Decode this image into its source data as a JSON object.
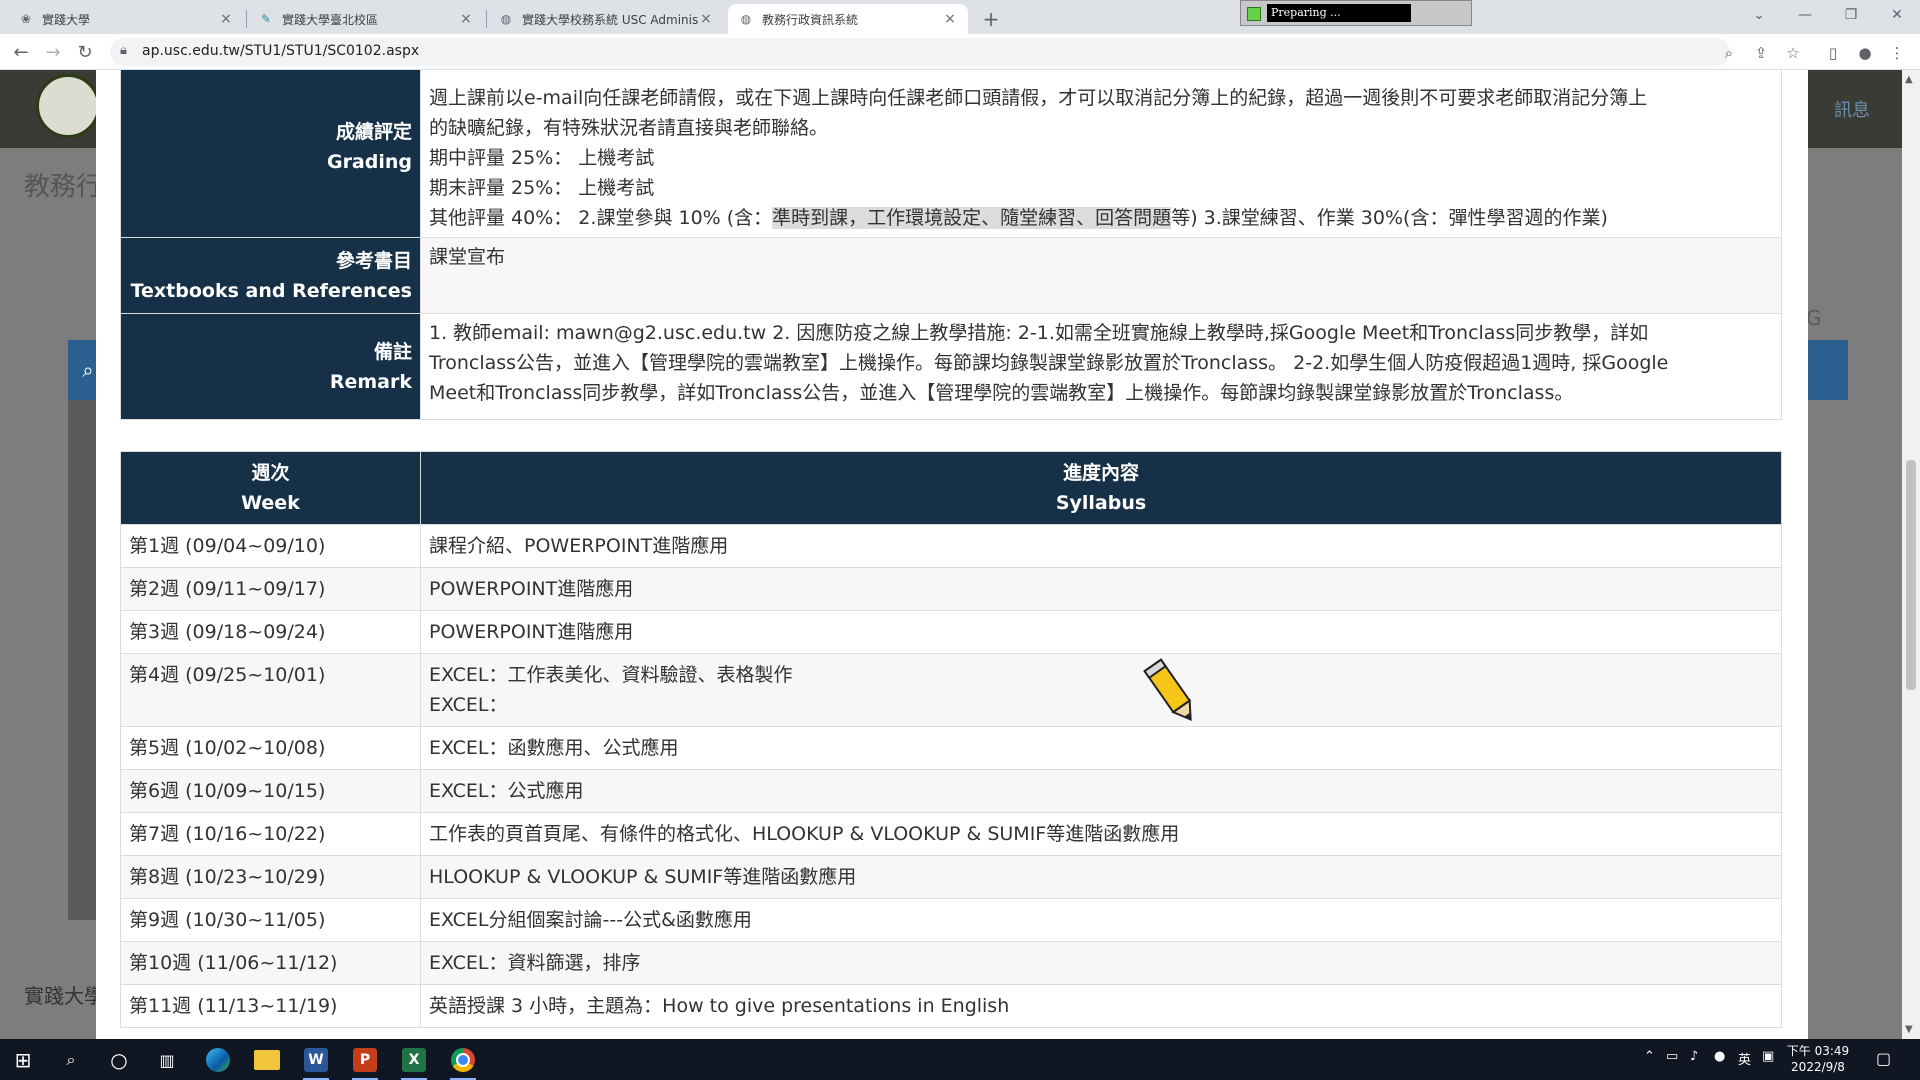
{
  "browser": {
    "tabs": [
      {
        "title": "實踐大學",
        "active": false
      },
      {
        "title": "實踐大學臺北校區",
        "active": false
      },
      {
        "title": "實踐大學校務系統 USC Adminis",
        "active": false
      },
      {
        "title": "教務行政資訊系統",
        "active": true
      }
    ],
    "new_tab": "+",
    "preparing_label": "Preparing ...",
    "url": "ap.usc.edu.tw/STU1/STU1/SC0102.aspx"
  },
  "background": {
    "page_title": "教務行",
    "right_link": "訊息",
    "footer_text": "實踐大學",
    "side_letter": "G"
  },
  "info": {
    "grading": {
      "label_zh": "成績評定",
      "label_en": "Grading",
      "lines": [
        "週上課前以e-mail向任課老師請假，或在下週上課時向任課老師口頭請假，才可以取消記分簿上的紀錄，超過一週後則不可要求老師取消記分簿上",
        "的缺曠紀錄，有特殊狀況者請直接與老師聯絡。",
        "期中評量 25%： 上機考試",
        "期末評量 25%： 上機考試"
      ],
      "other_prefix": "其他評量 40%： 2.課堂參與 10% (含：",
      "other_highlight": "準時到課，工作環境設定、隨堂練習、回答問題",
      "other_suffix": "等) 3.課堂練習、作業 30%(含：彈性學習週的作業)"
    },
    "textbooks": {
      "label_zh": "參考書目",
      "label_en": "Textbooks and References",
      "value": "課堂宣布"
    },
    "remark": {
      "label_zh": "備註",
      "label_en": "Remark",
      "lines": [
        "1. 教師email: mawn@g2.usc.edu.tw 2. 因應防疫之線上教學措施: 2-1.如需全班實施線上教學時,採Google Meet和Tronclass同步教學，詳如",
        "Tronclass公告，並進入【管理學院的雲端教室】上機操作。每節課均錄製課堂錄影放置於Tronclass。 2-2.如學生個人防疫假超過1週時, 採Google",
        "Meet和Tronclass同步教學，詳如Tronclass公告，並進入【管理學院的雲端教室】上機操作。每節課均錄製課堂錄影放置於Tronclass。"
      ]
    }
  },
  "syllabus": {
    "header_week_zh": "週次",
    "header_week_en": "Week",
    "header_content_zh": "進度內容",
    "header_content_en": "Syllabus",
    "rows": [
      {
        "week": "第1週 (09/04~09/10)",
        "content": [
          "課程介紹、POWERPOINT進階應用"
        ]
      },
      {
        "week": "第2週 (09/11~09/17)",
        "content": [
          "POWERPOINT進階應用"
        ]
      },
      {
        "week": "第3週 (09/18~09/24)",
        "content": [
          "POWERPOINT進階應用"
        ]
      },
      {
        "week": "第4週 (09/25~10/01)",
        "content": [
          "EXCEL：工作表美化、資料驗證、表格製作",
          "EXCEL："
        ]
      },
      {
        "week": "第5週 (10/02~10/08)",
        "content": [
          "EXCEL：函數應用、公式應用"
        ]
      },
      {
        "week": "第6週 (10/09~10/15)",
        "content": [
          "EXCEL：公式應用"
        ]
      },
      {
        "week": "第7週 (10/16~10/22)",
        "content": [
          "工作表的頁首頁尾、有條件的格式化、HLOOKUP & VLOOKUP & SUMIF等進階函數應用"
        ]
      },
      {
        "week": "第8週 (10/23~10/29)",
        "content": [
          "HLOOKUP & VLOOKUP & SUMIF等進階函數應用"
        ]
      },
      {
        "week": "第9週 (10/30~11/05)",
        "content": [
          "EXCEL分組個案討論---公式&函數應用"
        ]
      },
      {
        "week": "第10週 (11/06~11/12)",
        "content": [
          "EXCEL：資料篩選，排序"
        ]
      },
      {
        "week": "第11週 (11/13~11/19)",
        "content": [
          "英語授課 3 小時，主題為：How to give presentations in English"
        ]
      }
    ]
  },
  "taskbar": {
    "tray_ime": "英",
    "clock_period": "下午 03:49",
    "clock_date": "2022/9/8",
    "word_label": "W",
    "ppt_label": "P",
    "excel_label": "X"
  }
}
